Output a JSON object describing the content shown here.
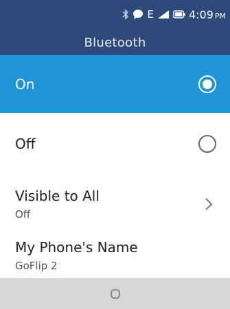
{
  "status_bar": {
    "icons": [
      "bluetooth-icon",
      "message-icon",
      "network-e-icon",
      "signal-icon",
      "battery-icon"
    ],
    "network_label": "E",
    "time": "4:09",
    "ampm": "PM"
  },
  "header": {
    "title": "Bluetooth"
  },
  "options": {
    "on": {
      "label": "On",
      "selected": true
    },
    "off": {
      "label": "Off",
      "selected": false
    }
  },
  "visible": {
    "label": "Visible to All",
    "value": "Off"
  },
  "phone_name": {
    "label": "My Phone's Name",
    "value": "GoFlip 2"
  },
  "colors": {
    "header": "#2e4a7a",
    "accent": "#1f95d6",
    "footer": "#d7d7d7"
  }
}
